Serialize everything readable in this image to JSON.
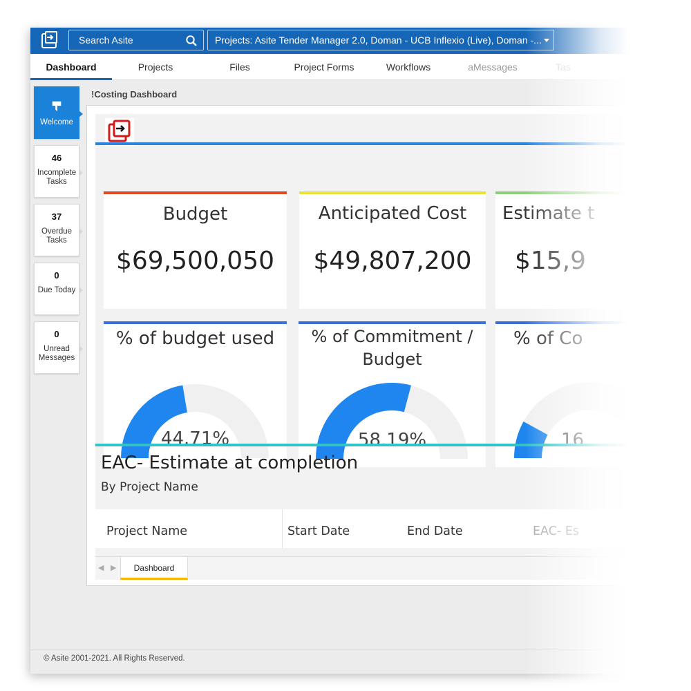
{
  "topbar": {
    "search_placeholder": "Search Asite",
    "project_selector": "Projects: Asite Tender Manager 2.0, Doman - UCB Inflexio (Live), Doman -...",
    "bar_color": "#1666b8"
  },
  "nav": {
    "tabs": [
      {
        "label": "Dashboard",
        "active": true
      },
      {
        "label": "Projects"
      },
      {
        "label": "Files"
      },
      {
        "label": "Project Forms"
      },
      {
        "label": "Workflows"
      },
      {
        "label": "aMessages"
      },
      {
        "label": "Tas"
      }
    ]
  },
  "sidebar": {
    "welcome_label": "Welcome",
    "items": [
      {
        "count": "46",
        "label": "Incomplete Tasks"
      },
      {
        "count": "37",
        "label": "Overdue Tasks"
      },
      {
        "count": "0",
        "label": "Due Today"
      },
      {
        "count": "0",
        "label": "Unread Messages"
      }
    ]
  },
  "breadcrumb": "!Costing Dashboard",
  "kpis": [
    {
      "title": "Budget",
      "value": "$69,500,050",
      "bar_color": "#e04a26"
    },
    {
      "title": "Anticipated Cost",
      "value": "$49,807,200",
      "bar_color": "#e8e23a"
    },
    {
      "title": "Estimate t",
      "value": "$15,9",
      "bar_color": "#8dd17a"
    }
  ],
  "gauges": [
    {
      "title": "% of budget used",
      "value_label": "44.71%",
      "value": 0.4471,
      "bar_color": "#3a6fe0"
    },
    {
      "title": "% of Commitment / Budget",
      "value_label": "58.19%",
      "value": 0.5819,
      "bar_color": "#3a6fe0"
    },
    {
      "title": "% of Co",
      "value_label": "16",
      "value": 0.16,
      "bar_color": "#3a6fe0"
    }
  ],
  "eac": {
    "title": "EAC- Estimate at completion",
    "subtitle": "By Project Name",
    "columns": [
      "Project Name",
      "Start Date",
      "End Date",
      "EAC- Es"
    ]
  },
  "sheet_tab": "Dashboard",
  "footer": "© Asite 2001-2021. All Rights Reserved."
}
